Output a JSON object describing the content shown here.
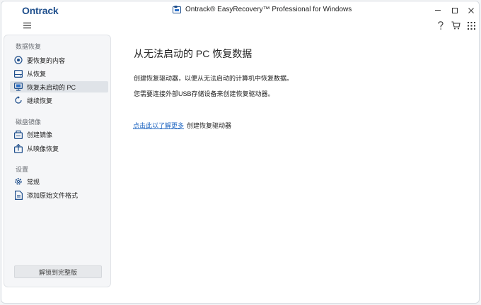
{
  "titlebar": {
    "brand": "Ontrack",
    "title": "Ontrack® EasyRecovery™ Professional for Windows"
  },
  "sidebar": {
    "sections": [
      {
        "label": "数据恢复",
        "items": [
          {
            "label": "要恢复的内容",
            "icon": "target-icon",
            "active": false
          },
          {
            "label": "从恢复",
            "icon": "drive-icon",
            "active": false
          },
          {
            "label": "恢复未启动的 PC",
            "icon": "monitor-icon",
            "active": true
          },
          {
            "label": "继续恢复",
            "icon": "resume-icon",
            "active": false
          }
        ]
      },
      {
        "label": "磁盘镜像",
        "items": [
          {
            "label": "创建镜像",
            "icon": "create-image-icon",
            "active": false
          },
          {
            "label": "从映像恢复",
            "icon": "restore-image-icon",
            "active": false
          }
        ]
      },
      {
        "label": "设置",
        "items": [
          {
            "label": "常规",
            "icon": "gear-icon",
            "active": false
          },
          {
            "label": "添加原始文件格式",
            "icon": "file-format-icon",
            "active": false
          }
        ]
      }
    ],
    "unlock_button": "解锁到完整版"
  },
  "main": {
    "title": "从无法启动的 PC 恢复数据",
    "para1": "创建恢复驱动器，以便从无法启动的计算机中恢复数据。",
    "para2": "您需要连接外部USB存储设备来创建恢复驱动器。",
    "link": "点击此以了解更多",
    "link_suffix": "创建恢复驱动器"
  },
  "colors": {
    "accent": "#2469c3",
    "brand": "#1f4f8c",
    "sidebar_bg": "#f5f6f8",
    "active_bg": "#dfe3e8"
  }
}
